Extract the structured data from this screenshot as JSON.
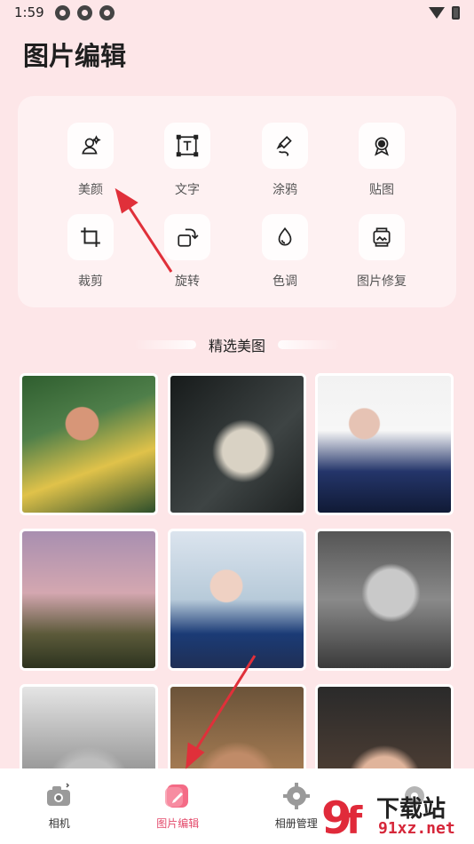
{
  "status_bar": {
    "time": "1:59",
    "notification_icons": [
      "notif-icon",
      "notif-icon",
      "notif-icon"
    ],
    "wifi_icon": "wifi-icon",
    "battery_icon": "battery-icon"
  },
  "header": {
    "title": "图片编辑"
  },
  "tools": [
    {
      "label": "美颜",
      "icon": "beauty-face-icon"
    },
    {
      "label": "文字",
      "icon": "text-icon"
    },
    {
      "label": "涂鸦",
      "icon": "doodle-brush-icon"
    },
    {
      "label": "贴图",
      "icon": "sticker-icon"
    },
    {
      "label": "裁剪",
      "icon": "crop-icon"
    },
    {
      "label": "旋转",
      "icon": "rotate-icon"
    },
    {
      "label": "色调",
      "icon": "color-tone-icon"
    },
    {
      "label": "图片修复",
      "icon": "photo-repair-icon"
    }
  ],
  "section": {
    "title": "精选美图"
  },
  "gallery": {
    "photos": [
      "photo-1",
      "photo-2",
      "photo-3",
      "photo-4",
      "photo-5",
      "photo-6",
      "photo-7",
      "photo-8",
      "photo-9"
    ]
  },
  "bottom_nav": {
    "items": [
      {
        "label": "相机",
        "icon": "camera-icon",
        "active": false
      },
      {
        "label": "图片编辑",
        "icon": "edit-icon",
        "active": true
      },
      {
        "label": "相册管理",
        "icon": "gear-icon",
        "active": false
      },
      {
        "label": "",
        "icon": "gear-icon",
        "active": false
      }
    ]
  },
  "watermark": {
    "text_top": "下载站",
    "text_bottom": "91xz.net",
    "mark": "9f"
  },
  "colors": {
    "background": "#fde6e8",
    "accent": "#e34a6b",
    "arrow": "#e0303a"
  }
}
